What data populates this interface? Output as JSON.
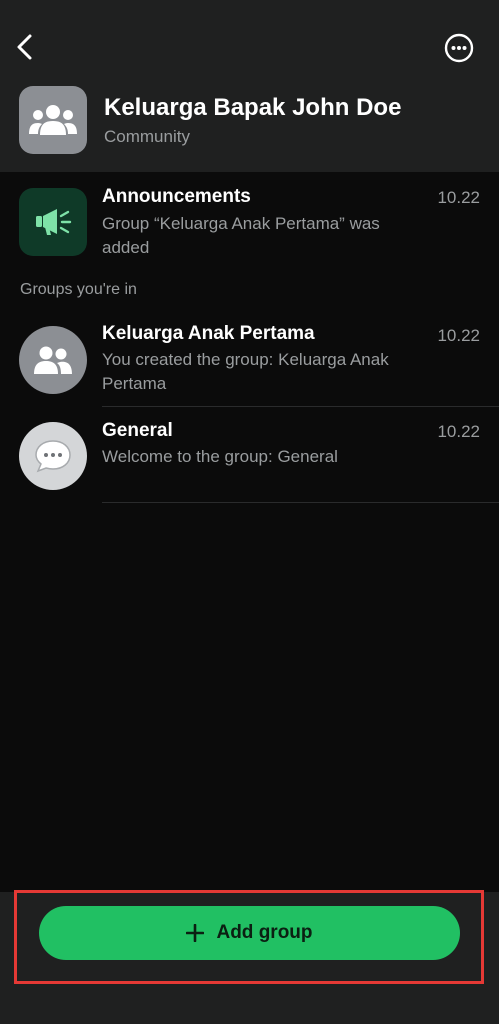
{
  "header": {
    "community_name": "Keluarga Bapak John Doe",
    "community_type": "Community",
    "back_icon": "chevron-left-icon",
    "more_icon": "more-horizontal-icon"
  },
  "announcements": {
    "title": "Announcements",
    "time": "10.22",
    "message": "Group “Keluarga Anak Pertama” was added",
    "icon": "megaphone-icon"
  },
  "section": {
    "groups_label": "Groups you're in"
  },
  "groups": [
    {
      "title": "Keluarga Anak Pertama",
      "time": "10.22",
      "message": "You created the group: Keluarga Anak Pertama",
      "icon": "group-icon"
    },
    {
      "title": "General",
      "time": "10.22",
      "message": "Welcome to the group: General",
      "icon": "chat-bubble-icon"
    }
  ],
  "footer": {
    "add_group_label": "Add group",
    "add_icon": "plus-icon"
  },
  "colors": {
    "accent": "#21c063",
    "highlight": "#e53935",
    "background": "#0b0b0b",
    "header_bg": "#1f2020"
  }
}
